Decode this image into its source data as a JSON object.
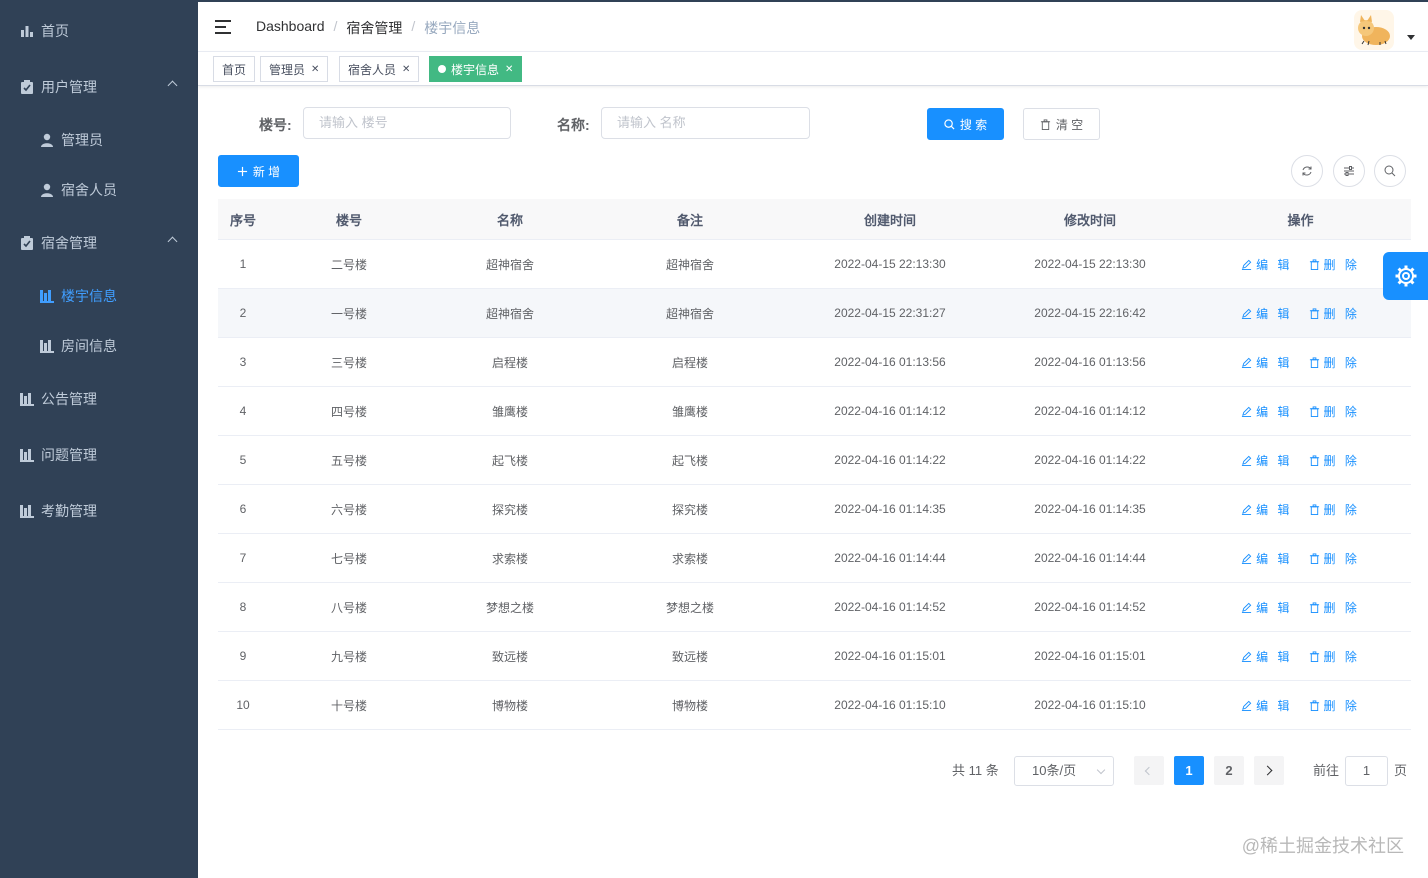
{
  "sidebar": {
    "items": [
      {
        "label": "首页",
        "icon": "chart-icon"
      },
      {
        "label": "用户管理",
        "icon": "clipboard-icon"
      },
      {
        "label": "管理员",
        "icon": "user-icon"
      },
      {
        "label": "宿舍人员",
        "icon": "user-icon"
      },
      {
        "label": "宿舍管理",
        "icon": "clipboard-icon"
      },
      {
        "label": "楼宇信息",
        "icon": "building-icon"
      },
      {
        "label": "房间信息",
        "icon": "building-icon"
      },
      {
        "label": "公告管理",
        "icon": "building-icon"
      },
      {
        "label": "问题管理",
        "icon": "building-icon"
      },
      {
        "label": "考勤管理",
        "icon": "building-icon"
      }
    ],
    "colors": {
      "bg": "#304156",
      "text": "#bfcbd9",
      "active": "#409eff"
    }
  },
  "breadcrumb": [
    "Dashboard",
    "宿舍管理",
    "楼宇信息"
  ],
  "tags": [
    "首页",
    "管理员",
    "宿舍人员",
    "楼宇信息"
  ],
  "search": {
    "building_label": "楼号:",
    "building_placeholder": "请输入 楼号",
    "name_label": "名称:",
    "name_placeholder": "请输入 名称",
    "search_button": "搜 索",
    "clear_button": "清 空"
  },
  "add_button": "新 增",
  "table": {
    "headers": [
      "序号",
      "楼号",
      "名称",
      "备注",
      "创建时间",
      "修改时间",
      "操作"
    ],
    "edit_label": "编 辑",
    "delete_label": "删 除",
    "rows": [
      [
        "1",
        "二号楼",
        "超神宿舍",
        "超神宿舍",
        "2022-04-15 22:13:30",
        "2022-04-15 22:13:30"
      ],
      [
        "2",
        "一号楼",
        "超神宿舍",
        "超神宿舍",
        "2022-04-15 22:31:27",
        "2022-04-15 22:16:42"
      ],
      [
        "3",
        "三号楼",
        "启程楼",
        "启程楼",
        "2022-04-16 01:13:56",
        "2022-04-16 01:13:56"
      ],
      [
        "4",
        "四号楼",
        "雏鹰楼",
        "雏鹰楼",
        "2022-04-16 01:14:12",
        "2022-04-16 01:14:12"
      ],
      [
        "5",
        "五号楼",
        "起飞楼",
        "起飞楼",
        "2022-04-16 01:14:22",
        "2022-04-16 01:14:22"
      ],
      [
        "6",
        "六号楼",
        "探究楼",
        "探究楼",
        "2022-04-16 01:14:35",
        "2022-04-16 01:14:35"
      ],
      [
        "7",
        "七号楼",
        "求索楼",
        "求索楼",
        "2022-04-16 01:14:44",
        "2022-04-16 01:14:44"
      ],
      [
        "8",
        "八号楼",
        "梦想之楼",
        "梦想之楼",
        "2022-04-16 01:14:52",
        "2022-04-16 01:14:52"
      ],
      [
        "9",
        "九号楼",
        "致远楼",
        "致远楼",
        "2022-04-16 01:15:01",
        "2022-04-16 01:15:01"
      ],
      [
        "10",
        "十号楼",
        "博物楼",
        "博物楼",
        "2022-04-16 01:15:10",
        "2022-04-16 01:15:10"
      ]
    ]
  },
  "pagination": {
    "total_text": "共 11 条",
    "page_size": "10条/页",
    "pages": [
      "1",
      "2"
    ],
    "current_page": "1",
    "goto_prefix": "前往",
    "goto_value": "1",
    "goto_suffix": "页"
  },
  "watermark": "@稀土掘金技术社区",
  "accent_color": "#1890ff"
}
